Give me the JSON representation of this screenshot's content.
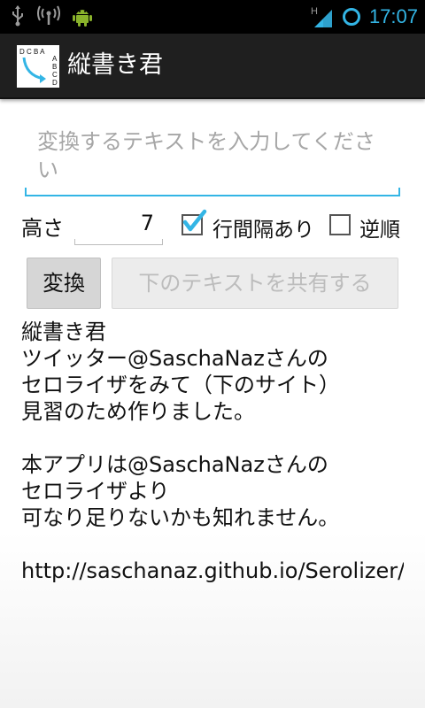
{
  "status_bar": {
    "time": "17:07",
    "network_type": "H",
    "icons": [
      "usb-icon",
      "wifi-hotspot-icon",
      "android-debug-icon",
      "signal-icon",
      "sync-circle-icon"
    ],
    "accent_color": "#33b5e5"
  },
  "action_bar": {
    "title": "縦書き君",
    "icon_letters_top": "D C B A",
    "icon_letters_side": [
      "A",
      "B",
      "C",
      "D"
    ]
  },
  "input": {
    "placeholder": "変換するテキストを入力してください",
    "value": ""
  },
  "options": {
    "height_label": "高さ",
    "height_value": "7",
    "line_spacing_label": "行間隔あり",
    "line_spacing_checked": true,
    "reverse_label": "逆順",
    "reverse_checked": false
  },
  "buttons": {
    "convert_label": "変換",
    "share_label": "下のテキストを共有する"
  },
  "output_text": "縦書き君\nツイッター@SaschaNazさんの\nセロライザをみて（下のサイト）\n見習のため作りました。\n\n本アプリは@SaschaNazさんの\nセロライザより\n可なり足りないかも知れません。\n\nhttp://saschanaz.github.io/Serolizer/"
}
